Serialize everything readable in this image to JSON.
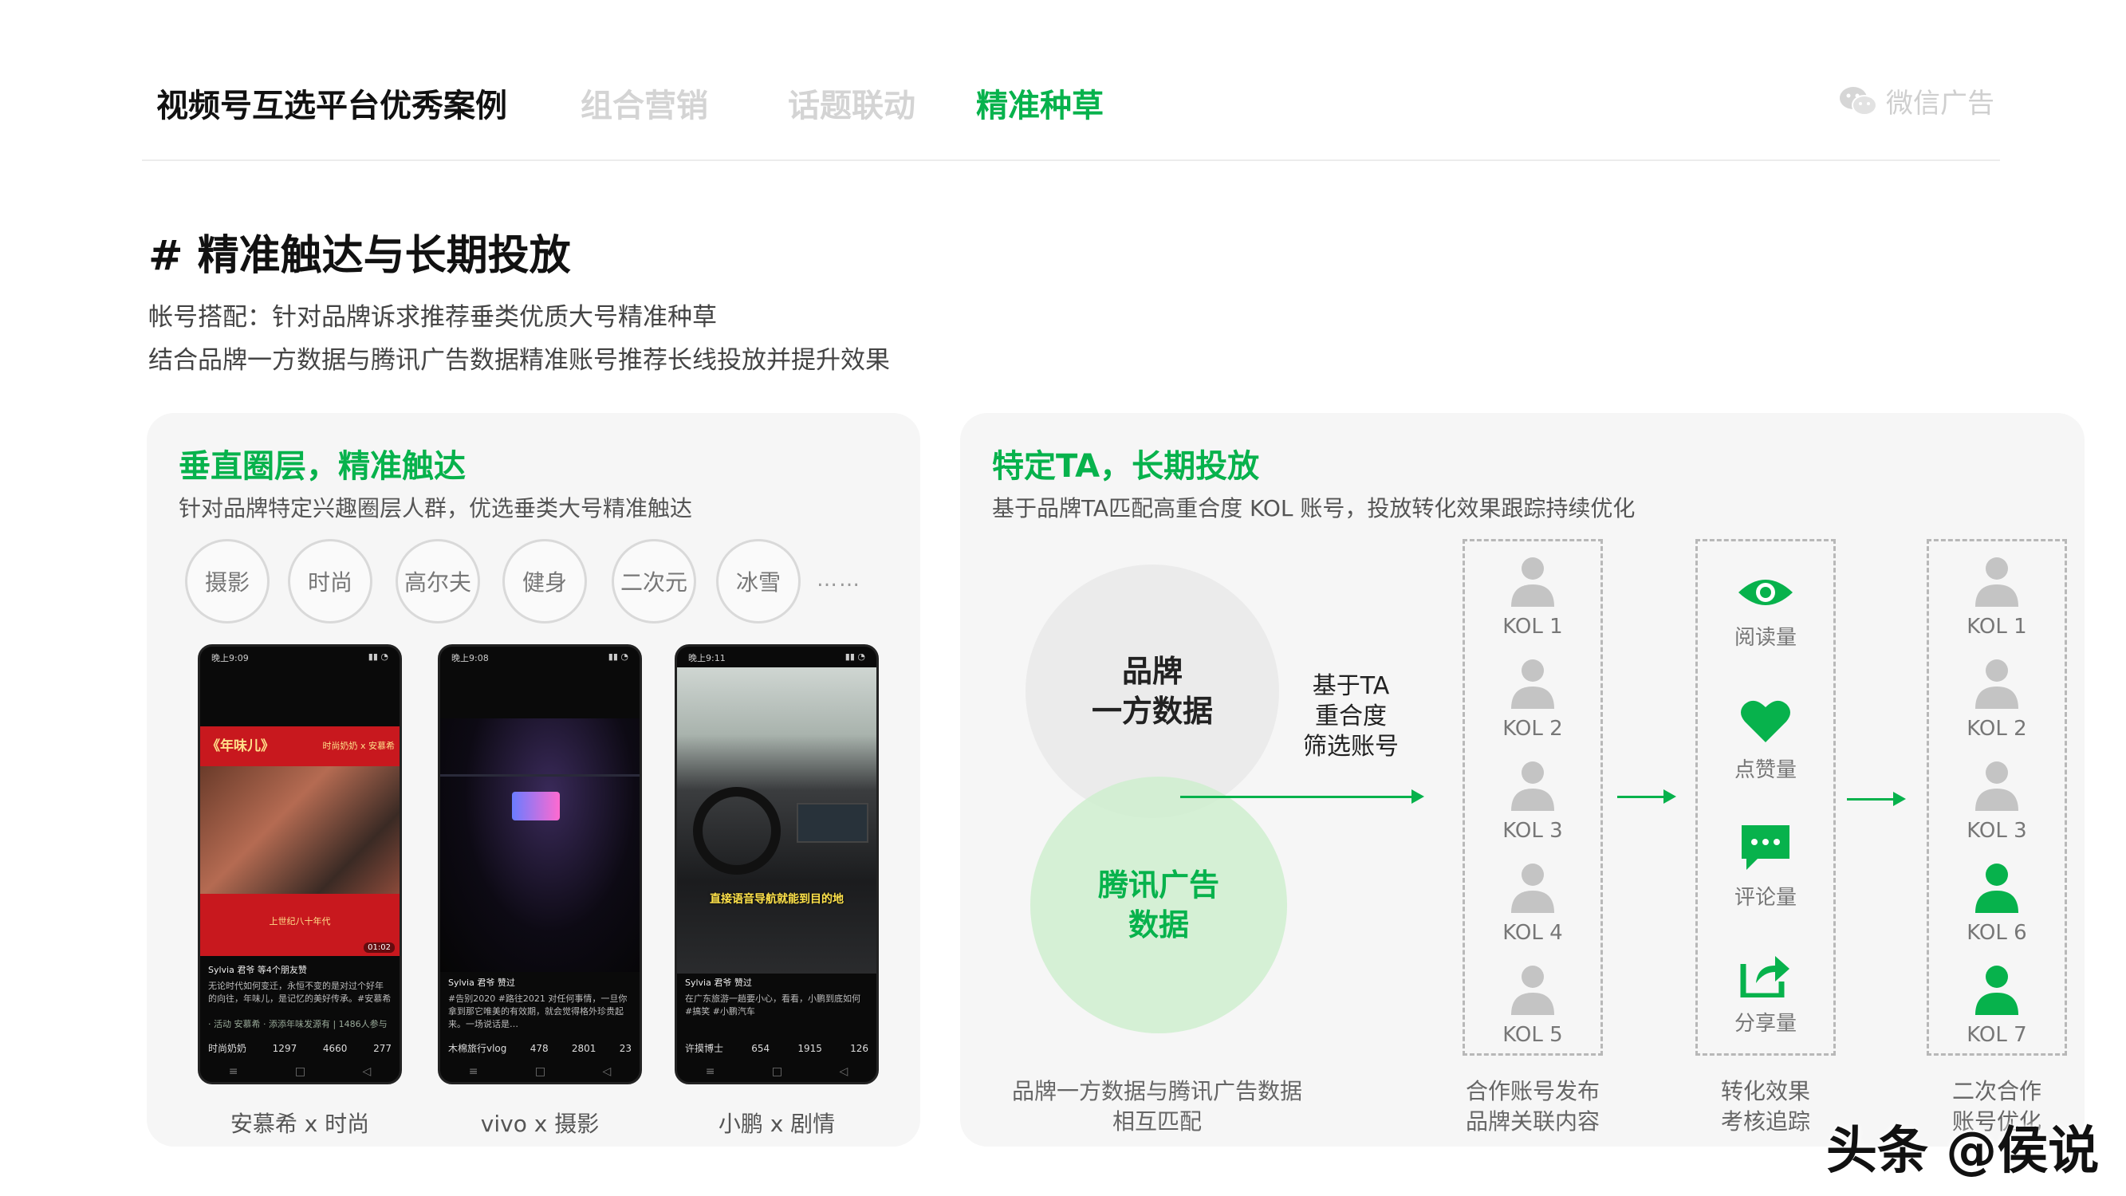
{
  "header": {
    "title": "视频号互选平台优秀案例",
    "tabs": [
      {
        "label": "组合营销",
        "active": false
      },
      {
        "label": "话题联动",
        "active": false
      },
      {
        "label": "精准种草",
        "active": true
      }
    ],
    "brand": "微信广告",
    "brand_icon": "wechat-icon"
  },
  "section": {
    "title": "# 精准触达与长期投放",
    "lines": [
      "帐号搭配：针对品牌诉求推荐垂类优质大号精准种草",
      "结合品牌一方数据与腾讯广告数据精准账号推荐长线投放并提升效果"
    ]
  },
  "left_panel": {
    "title": "垂直圈层，精准触达",
    "subtitle": "针对品牌特定兴趣圈层人群，优选垂类大号精准触达",
    "tags": [
      "摄影",
      "时尚",
      "高尔夫",
      "健身",
      "二次元",
      "冰雪"
    ],
    "ellipsis": "……",
    "phones": [
      {
        "caption": "安慕希 x 时尚",
        "status_time": "晚上9:09",
        "overlay_title": "《年味儿》",
        "overlay_badge": "时尚奶奶 x 安慕希",
        "overlay_sub": "上世纪八十年代",
        "duration": "01:02",
        "author": "Sylvia 君爷 等4个朋友赞",
        "desc": "无论时代如何变迁，永恒不变的是对过个好年的向往，年味儿，是记忆的美好传承。#安慕希",
        "tag_line": "· 活动 安慕希 · 添添年味发源有 | 1486人参与",
        "account": "时尚奶奶",
        "counts": [
          "1297",
          "4660",
          "277"
        ]
      },
      {
        "caption": "vivo x 摄影",
        "status_time": "晚上9:08",
        "author": "Sylvia 君爷 赞过",
        "desc": "#告别2020 #路往2021 对任何事情，一旦你拿到那它唯美的有效期，就会觉得格外珍贵起来。一场说话是…",
        "account": "木棉旅行vlog",
        "counts": [
          "478",
          "2801",
          "23"
        ]
      },
      {
        "caption": "小鹏 x 剧情",
        "status_time": "晚上9:11",
        "overlay_title": "直接语音导航就能到目的地",
        "author": "Sylvia 君爷 赞过",
        "desc": "在广东旅游一趟要小心，看看，小鹏到底如何 #搞笑 #小鹏汽车",
        "account": "许摸博士",
        "counts": [
          "654",
          "1915",
          "126"
        ]
      }
    ]
  },
  "right_panel": {
    "title": "特定TA，长期投放",
    "subtitle": "基于品牌TA匹配高重合度 KOL 账号，投放转化效果跟踪持续优化",
    "circle_brand": [
      "品牌",
      "一方数据"
    ],
    "circle_tencent": [
      "腾讯广告",
      "数据"
    ],
    "ta_label": [
      "基于TA",
      "重合度",
      "筛选账号"
    ],
    "box1_kols": [
      "KOL 1",
      "KOL 2",
      "KOL 3",
      "KOL 4",
      "KOL 5"
    ],
    "metrics": [
      {
        "label": "阅读量",
        "icon": "eye-icon"
      },
      {
        "label": "点赞量",
        "icon": "heart-icon"
      },
      {
        "label": "评论量",
        "icon": "comment-icon"
      },
      {
        "label": "分享量",
        "icon": "share-icon"
      }
    ],
    "box3_kols": [
      {
        "label": "KOL 1",
        "highlight": false
      },
      {
        "label": "KOL 2",
        "highlight": false
      },
      {
        "label": "KOL 3",
        "highlight": false
      },
      {
        "label": "KOL 6",
        "highlight": true
      },
      {
        "label": "KOL 7",
        "highlight": true
      }
    ],
    "captions": {
      "match": [
        "品牌一方数据与腾讯广告数据",
        "相互匹配"
      ],
      "publish": [
        "合作账号发布",
        "品牌关联内容"
      ],
      "track": [
        "转化效果",
        "考核追踪"
      ],
      "optimize": [
        "二次合作",
        "账号优化"
      ]
    }
  },
  "colors": {
    "accent": "#07b24c",
    "muted": "#d4d4d4",
    "panel": "#f6f6f6",
    "person_gray": "#c4c4c4"
  },
  "watermark": "头条 @侯说"
}
